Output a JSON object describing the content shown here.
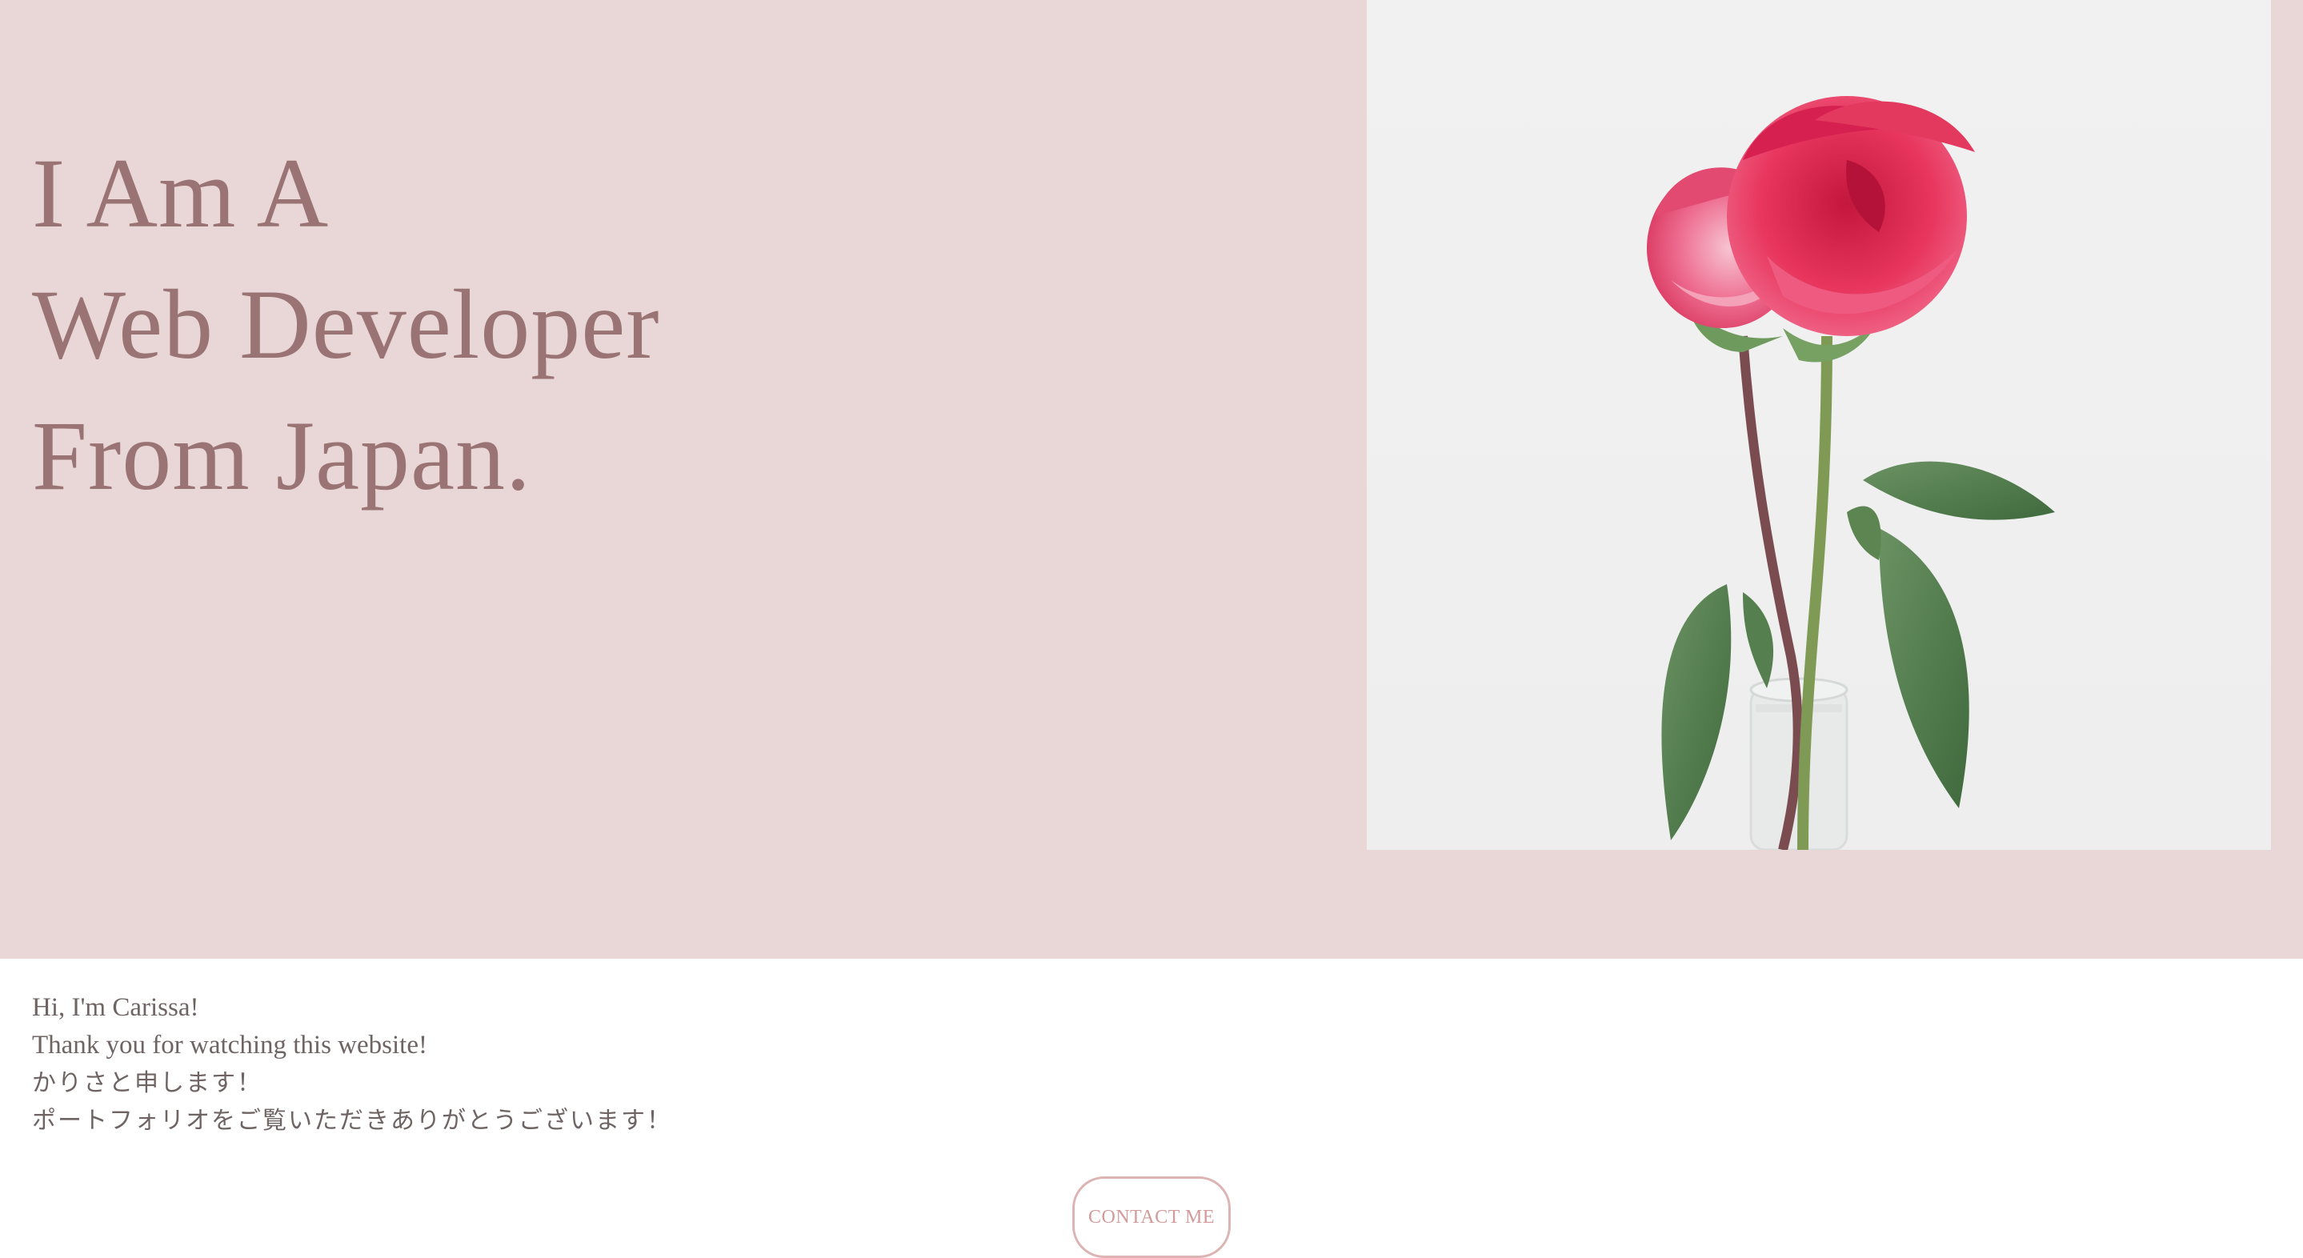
{
  "hero": {
    "headline": [
      "I Am A",
      "Web Developer",
      "From Japan."
    ],
    "background_color": "#e9d6d6",
    "headline_color": "#9a7474",
    "image": {
      "subject": "rose-photo",
      "rose_colors": [
        "#e8365e",
        "#f2709a"
      ],
      "leaf_color": "#4f7a4a",
      "background": "#f0f0f0"
    }
  },
  "intro": {
    "lines": [
      "Hi, I'm Carissa!",
      "Thank you for watching this website!",
      "かりさと申します！",
      "ポートフォリオをご覧いただきありがとうございます！"
    ]
  },
  "contact_button": {
    "label": "CONTACT ME",
    "border_color": "#dcb4b4",
    "text_color": "#d29a9a"
  }
}
